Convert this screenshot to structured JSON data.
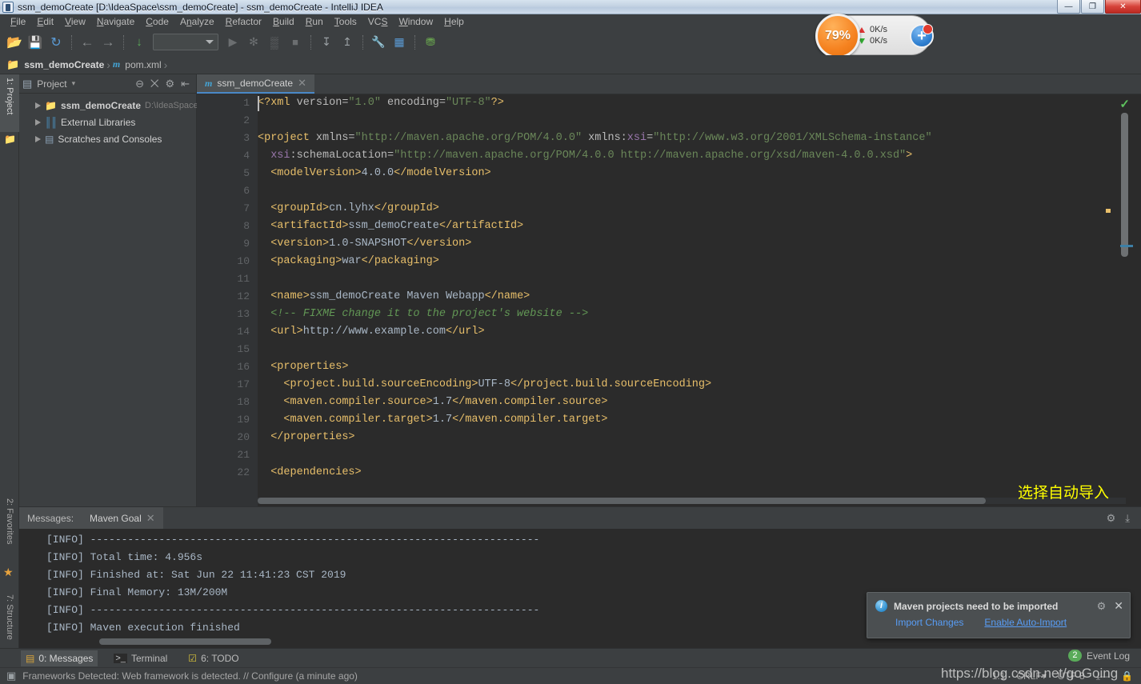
{
  "window": {
    "title": "ssm_demoCreate [D:\\IdeaSpace\\ssm_demoCreate] - ssm_demoCreate - IntelliJ IDEA",
    "app_icon": "intellij-idea-icon",
    "controls": {
      "minimize": "—",
      "maximize": "❐",
      "close": "✕"
    }
  },
  "menubar": {
    "items": [
      {
        "label": "File"
      },
      {
        "label": "Edit"
      },
      {
        "label": "View"
      },
      {
        "label": "Navigate"
      },
      {
        "label": "Code"
      },
      {
        "label": "Analyze"
      },
      {
        "label": "Refactor"
      },
      {
        "label": "Build"
      },
      {
        "label": "Run"
      },
      {
        "label": "Tools"
      },
      {
        "label": "VCS"
      },
      {
        "label": "Window"
      },
      {
        "label": "Help"
      }
    ]
  },
  "toolbar": {
    "buttons": [
      {
        "name": "open-folder-icon",
        "glyph": "📂",
        "color": "#d9a14a"
      },
      {
        "name": "save-all-icon",
        "glyph": "💾",
        "color": "#b8bcbf"
      },
      {
        "name": "sync-refresh-icon",
        "glyph": "↻",
        "color": "#5b9bd5"
      },
      {
        "name": "back-arrow-icon",
        "glyph": "←",
        "color": "#8a8d8f"
      },
      {
        "name": "forward-arrow-icon",
        "glyph": "→",
        "color": "#8a8d8f"
      },
      {
        "name": "compile-icon",
        "glyph": "↓",
        "color": "#5aab5a"
      },
      {
        "name": "run-icon",
        "glyph": "▶",
        "color": "#6b6e70"
      },
      {
        "name": "debug-icon",
        "glyph": "🐞",
        "color": "#6b6e70"
      },
      {
        "name": "coverage-icon",
        "glyph": "▓",
        "color": "#6b6e70"
      },
      {
        "name": "stop-icon",
        "glyph": "■",
        "color": "#6b6e70"
      },
      {
        "name": "update-project-icon",
        "glyph": "⬇",
        "color": "#9aa0a4"
      },
      {
        "name": "commit-icon",
        "glyph": "⬆",
        "color": "#9aa0a4"
      },
      {
        "name": "settings-wrench-icon",
        "glyph": "🔧",
        "color": "#d9c24a"
      },
      {
        "name": "project-structure-icon",
        "glyph": "▦",
        "color": "#5b9bd5"
      },
      {
        "name": "sdk-manager-icon",
        "glyph": "⛁",
        "color": "#6aa84f"
      }
    ],
    "run_configuration_combo": {
      "value": "",
      "placeholder": ""
    }
  },
  "net_widget": {
    "percent_label": "79%",
    "upload_speed": "0K/s",
    "download_speed": "0K/s",
    "plus_label": "+",
    "accent_color": "#f58220"
  },
  "breadcrumb": {
    "items": [
      {
        "label": "ssm_demoCreate",
        "icon": "module-folder-icon",
        "bold": true
      },
      {
        "label": "pom.xml",
        "icon": "maven-m-icon",
        "bold": false
      }
    ],
    "separator": "›"
  },
  "left_strip": {
    "tabs": [
      {
        "label": "1: Project",
        "icon": "project-icon",
        "active": true
      },
      {
        "label": "2: Favorites",
        "icon": "favorites-star-icon",
        "active": false
      },
      {
        "label": "7: Structure",
        "icon": "structure-icon",
        "active": false
      }
    ]
  },
  "project_panel": {
    "title": "Project",
    "title_caret": "▾",
    "actions": [
      {
        "name": "collapse-all-icon",
        "glyph": "⊖"
      },
      {
        "name": "expand-scroll-icon",
        "glyph": "⨉"
      },
      {
        "name": "settings-gear-icon",
        "glyph": "⚙"
      },
      {
        "name": "hide-panel-icon",
        "glyph": "⇤"
      }
    ],
    "tree": [
      {
        "label": "ssm_demoCreate",
        "path": "D:\\IdeaSpace",
        "icon": "module-folder-icon",
        "bold": true,
        "expander": "▶"
      },
      {
        "label": "External Libraries",
        "path": "",
        "icon": "libraries-icon",
        "bold": false,
        "expander": "▶"
      },
      {
        "label": "Scratches and Consoles",
        "path": "",
        "icon": "scratches-icon",
        "bold": false,
        "expander": "▶"
      }
    ]
  },
  "editor": {
    "tab": {
      "label": "ssm_demoCreate",
      "icon": "maven-m-icon",
      "close": "✕"
    },
    "inspection_status": "✓",
    "caret_position": "1:1",
    "line_numbers": [
      1,
      2,
      3,
      4,
      5,
      6,
      7,
      8,
      9,
      10,
      11,
      12,
      13,
      14,
      15,
      16,
      17,
      18,
      19,
      20,
      21,
      22
    ],
    "folds": {
      "3": "minus",
      "16": "minus",
      "20": "end",
      "22": "minus"
    },
    "lines": [
      {
        "n": 1,
        "segments": [
          {
            "t": "tag",
            "s": "<?xml "
          },
          {
            "t": "attr",
            "s": "version="
          },
          {
            "t": "str",
            "s": "\"1.0\""
          },
          {
            "t": "attr",
            "s": " encoding="
          },
          {
            "t": "str",
            "s": "\"UTF-8\""
          },
          {
            "t": "tag",
            "s": "?>"
          }
        ]
      },
      {
        "n": 2,
        "segments": []
      },
      {
        "n": 3,
        "segments": [
          {
            "t": "tag",
            "s": "<project "
          },
          {
            "t": "attr",
            "s": "xmlns="
          },
          {
            "t": "str",
            "s": "\"http://maven.apache.org/POM/4.0.0\""
          },
          {
            "t": "attr",
            "s": " xmlns:"
          },
          {
            "t": "ns",
            "s": "xsi"
          },
          {
            "t": "attr",
            "s": "="
          },
          {
            "t": "str",
            "s": "\"http://www.w3.org/2001/XMLSchema-instance\""
          }
        ]
      },
      {
        "n": 4,
        "segments": [
          {
            "t": "txt",
            "s": "  "
          },
          {
            "t": "ns",
            "s": "xsi"
          },
          {
            "t": "attr",
            "s": ":schemaLocation="
          },
          {
            "t": "str",
            "s": "\"http://maven.apache.org/POM/4.0.0 http://maven.apache.org/xsd/maven-4.0.0.xsd\""
          },
          {
            "t": "tag",
            "s": ">"
          }
        ]
      },
      {
        "n": 5,
        "segments": [
          {
            "t": "txt",
            "s": "  "
          },
          {
            "t": "tag",
            "s": "<modelVersion>"
          },
          {
            "t": "txt",
            "s": "4.0.0"
          },
          {
            "t": "tag",
            "s": "</modelVersion>"
          }
        ]
      },
      {
        "n": 6,
        "segments": []
      },
      {
        "n": 7,
        "segments": [
          {
            "t": "txt",
            "s": "  "
          },
          {
            "t": "tag",
            "s": "<groupId>"
          },
          {
            "t": "txt",
            "s": "cn.lyhx"
          },
          {
            "t": "tag",
            "s": "</groupId>"
          }
        ]
      },
      {
        "n": 8,
        "segments": [
          {
            "t": "txt",
            "s": "  "
          },
          {
            "t": "tag",
            "s": "<artifactId>"
          },
          {
            "t": "txt",
            "s": "ssm_demoCreate"
          },
          {
            "t": "tag",
            "s": "</artifactId>"
          }
        ]
      },
      {
        "n": 9,
        "segments": [
          {
            "t": "txt",
            "s": "  "
          },
          {
            "t": "tag",
            "s": "<version>"
          },
          {
            "t": "txt",
            "s": "1.0-SNAPSHOT"
          },
          {
            "t": "tag",
            "s": "</version>"
          }
        ]
      },
      {
        "n": 10,
        "segments": [
          {
            "t": "txt",
            "s": "  "
          },
          {
            "t": "tag",
            "s": "<packaging>"
          },
          {
            "t": "txt",
            "s": "war"
          },
          {
            "t": "tag",
            "s": "</packaging>"
          }
        ]
      },
      {
        "n": 11,
        "segments": []
      },
      {
        "n": 12,
        "segments": [
          {
            "t": "txt",
            "s": "  "
          },
          {
            "t": "tag",
            "s": "<name>"
          },
          {
            "t": "txt",
            "s": "ssm_demoCreate Maven Webapp"
          },
          {
            "t": "tag",
            "s": "</name>"
          }
        ]
      },
      {
        "n": 13,
        "segments": [
          {
            "t": "txt",
            "s": "  "
          },
          {
            "t": "cmt",
            "s": "<!-- FIXME change it to the project's website -->"
          }
        ]
      },
      {
        "n": 14,
        "segments": [
          {
            "t": "txt",
            "s": "  "
          },
          {
            "t": "tag",
            "s": "<url>"
          },
          {
            "t": "txt",
            "s": "http://www.example.com"
          },
          {
            "t": "tag",
            "s": "</url>"
          }
        ]
      },
      {
        "n": 15,
        "segments": []
      },
      {
        "n": 16,
        "segments": [
          {
            "t": "txt",
            "s": "  "
          },
          {
            "t": "tag",
            "s": "<properties>"
          }
        ]
      },
      {
        "n": 17,
        "segments": [
          {
            "t": "txt",
            "s": "    "
          },
          {
            "t": "tag",
            "s": "<project.build.sourceEncoding>"
          },
          {
            "t": "txt",
            "s": "UTF-8"
          },
          {
            "t": "tag",
            "s": "</project.build.sourceEncoding>"
          }
        ]
      },
      {
        "n": 18,
        "segments": [
          {
            "t": "txt",
            "s": "    "
          },
          {
            "t": "tag",
            "s": "<maven.compiler.source>"
          },
          {
            "t": "txt",
            "s": "1.7"
          },
          {
            "t": "tag",
            "s": "</maven.compiler.source>"
          }
        ]
      },
      {
        "n": 19,
        "segments": [
          {
            "t": "txt",
            "s": "    "
          },
          {
            "t": "tag",
            "s": "<maven.compiler.target>"
          },
          {
            "t": "txt",
            "s": "1.7"
          },
          {
            "t": "tag",
            "s": "</maven.compiler.target>"
          }
        ]
      },
      {
        "n": 20,
        "segments": [
          {
            "t": "txt",
            "s": "  "
          },
          {
            "t": "tag",
            "s": "</properties>"
          }
        ]
      },
      {
        "n": 21,
        "segments": []
      },
      {
        "n": 22,
        "segments": [
          {
            "t": "txt",
            "s": "  "
          },
          {
            "t": "tag",
            "s": "<dependencies>"
          }
        ]
      }
    ]
  },
  "messages_panel": {
    "label": "Messages:",
    "tab": {
      "label": "Maven Goal",
      "close": "✕"
    },
    "actions": [
      {
        "name": "settings-gear-icon",
        "glyph": "⚙"
      },
      {
        "name": "export-to-file-icon",
        "glyph": "⤓"
      }
    ],
    "lines": [
      "[INFO] ------------------------------------------------------------------------",
      "[INFO] Total time: 4.956s",
      "[INFO] Finished at: Sat Jun 22 11:41:23 CST 2019",
      "[INFO] Final Memory: 13M/200M",
      "[INFO] ------------------------------------------------------------------------",
      "[INFO] Maven execution finished"
    ]
  },
  "annotation": {
    "text": "选择自动导入",
    "color": "#ffff00",
    "arrow_color": "#ff2b2b"
  },
  "notification": {
    "icon": "info-icon",
    "title": "Maven projects need to be imported",
    "links": [
      {
        "label": "Import Changes",
        "underlined": false
      },
      {
        "label": "Enable Auto-Import",
        "underlined": true
      }
    ],
    "actions": [
      {
        "name": "settings-gear-icon",
        "glyph": "⚙"
      },
      {
        "name": "close-icon",
        "glyph": "✕"
      }
    ]
  },
  "bottom_tabs": {
    "items": [
      {
        "label": "0: Messages",
        "icon": "messages-icon",
        "active": true
      },
      {
        "label": "Terminal",
        "icon": "terminal-icon",
        "active": false
      },
      {
        "label": "6: TODO",
        "icon": "todo-icon",
        "active": false
      }
    ]
  },
  "event_log": {
    "badge": "2",
    "label": "Event Log"
  },
  "statusbar": {
    "message": "Frameworks Detected: Web framework is detected. // Configure (a minute ago)",
    "icon": "framework-detected-icon",
    "right": [
      {
        "label": "1:1"
      },
      {
        "label": "CRLF▾"
      },
      {
        "label": "UTF-8"
      },
      {
        "label": "⤓—"
      },
      {
        "label": "🔒"
      }
    ]
  },
  "watermark": {
    "text": "https://blog.csdn.net/goGoing"
  }
}
